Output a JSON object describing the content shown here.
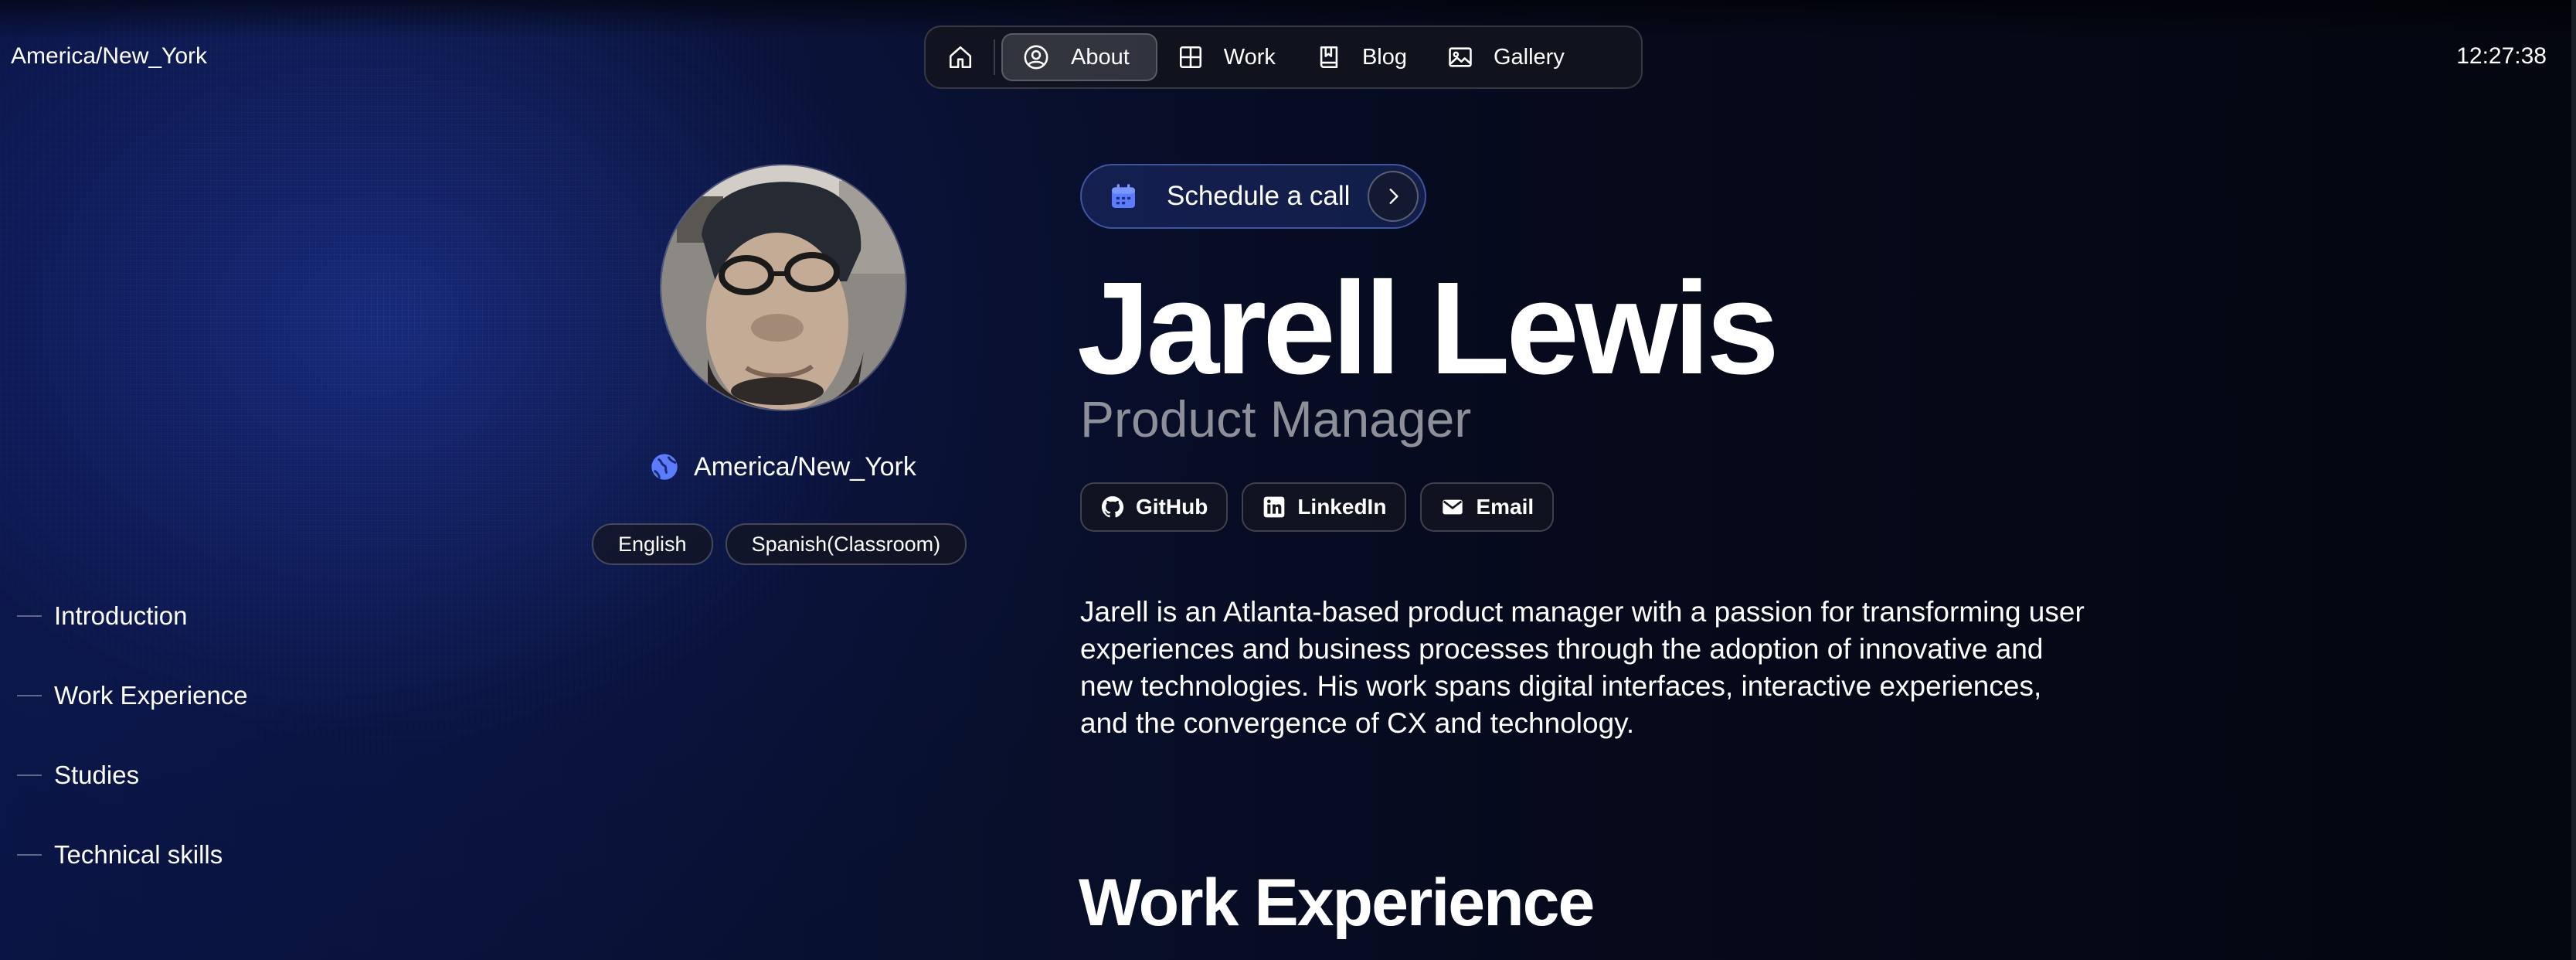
{
  "header": {
    "timezone": "America/New_York",
    "clock": "12:27:38"
  },
  "nav": {
    "items": [
      {
        "label": "",
        "icon": "home-icon"
      },
      {
        "label": "About",
        "icon": "user-circle-icon",
        "active": true
      },
      {
        "label": "Work",
        "icon": "grid-icon"
      },
      {
        "label": "Blog",
        "icon": "book-icon"
      },
      {
        "label": "Gallery",
        "icon": "image-icon"
      }
    ]
  },
  "profile": {
    "location": "America/New_York",
    "languages": [
      "English",
      "Spanish(Classroom)"
    ]
  },
  "toc": {
    "items": [
      "Introduction",
      "Work Experience",
      "Studies",
      "Technical skills"
    ]
  },
  "hero": {
    "schedule_label": "Schedule a call",
    "name": "Jarell Lewis",
    "role": "Product Manager",
    "socials": [
      {
        "label": "GitHub",
        "icon": "github-icon"
      },
      {
        "label": "LinkedIn",
        "icon": "linkedin-icon"
      },
      {
        "label": "Email",
        "icon": "email-icon"
      }
    ],
    "bio": "Jarell is an Atlanta-based product manager with a passion for transforming user experiences and business processes through the adoption of innovative and new technologies. His work spans digital interfaces, interactive experiences, and the convergence of CX and technology."
  },
  "sections": {
    "work_title": "Work Experience"
  },
  "colors": {
    "accent": "#5b7cff",
    "role_text": "#8d8f99"
  }
}
